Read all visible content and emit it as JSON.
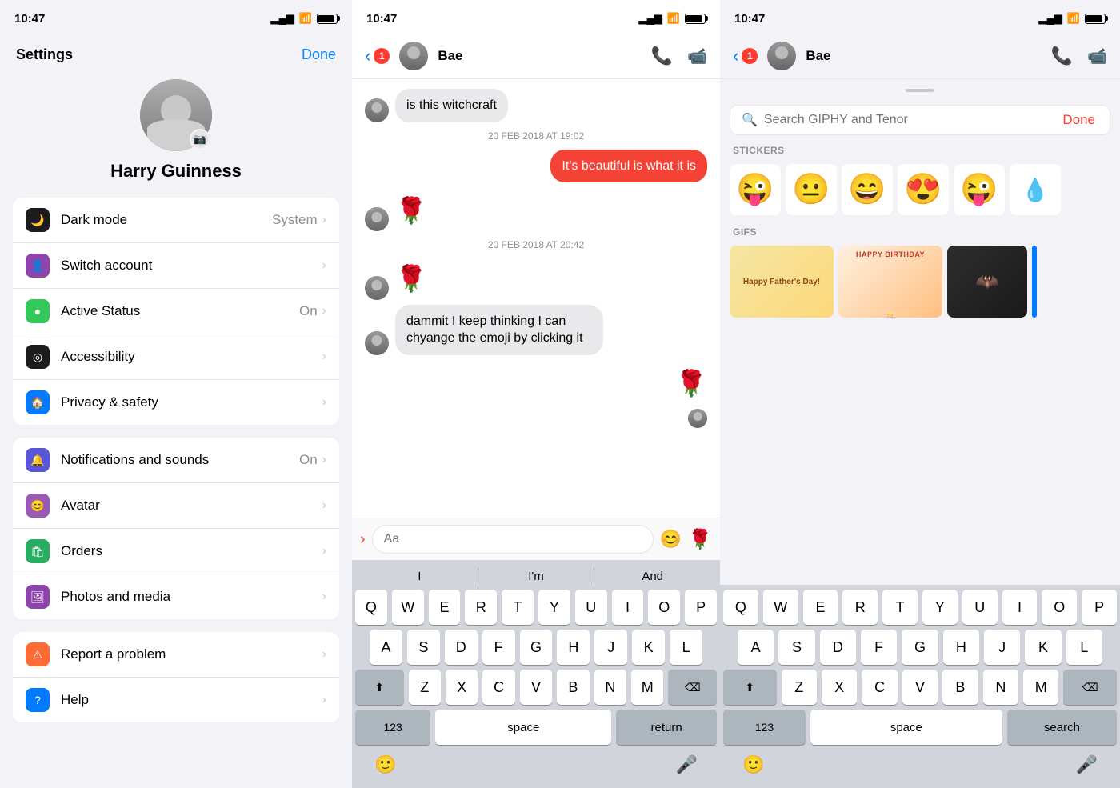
{
  "statusBar": {
    "time": "10:47",
    "signal": "▂▄▆",
    "wifi": "wifi",
    "battery": "battery"
  },
  "settings": {
    "title": "Settings",
    "done": "Done",
    "profileName": "Harry Guinness",
    "items": [
      {
        "id": "dark-mode",
        "label": "Dark mode",
        "value": "System",
        "iconColor": "black",
        "symbol": "🌙"
      },
      {
        "id": "switch-account",
        "label": "Switch account",
        "value": "",
        "iconColor": "purple",
        "symbol": "👤"
      },
      {
        "id": "active-status",
        "label": "Active Status",
        "value": "On",
        "iconColor": "green",
        "symbol": "●"
      },
      {
        "id": "accessibility",
        "label": "Accessibility",
        "value": "",
        "iconColor": "dark",
        "symbol": "◎"
      },
      {
        "id": "privacy-safety",
        "label": "Privacy & safety",
        "value": "",
        "iconColor": "blue",
        "symbol": "🏠"
      }
    ],
    "items2": [
      {
        "id": "notifications",
        "label": "Notifications and sounds",
        "value": "On",
        "iconColor": "purple2",
        "symbol": "🔔"
      },
      {
        "id": "avatar",
        "label": "Avatar",
        "value": "",
        "iconColor": "purple3",
        "symbol": "😊"
      },
      {
        "id": "orders",
        "label": "Orders",
        "value": "",
        "iconColor": "green2",
        "symbol": "🛍"
      },
      {
        "id": "photos-media",
        "label": "Photos and media",
        "value": "",
        "iconColor": "purple4",
        "symbol": "🖼"
      }
    ],
    "items3": [
      {
        "id": "report-problem",
        "label": "Report a problem",
        "value": "",
        "iconColor": "orange",
        "symbol": "⚠"
      },
      {
        "id": "help",
        "label": "Help",
        "value": "",
        "iconColor": "blue2",
        "symbol": "?"
      }
    ]
  },
  "chat": {
    "contactName": "Bae",
    "badge": "1",
    "messages": [
      {
        "type": "received",
        "text": "is this witchcraft",
        "avatar": true
      },
      {
        "type": "timestamp",
        "text": "20 FEB 2018 AT 19:02"
      },
      {
        "type": "sent",
        "text": "It's beautiful is what it is"
      },
      {
        "type": "received-emoji",
        "emoji": "🌹",
        "avatar": true
      },
      {
        "type": "timestamp",
        "text": "20 FEB 2018 AT 20:42"
      },
      {
        "type": "received-emoji",
        "emoji": "🌹",
        "avatar": true
      },
      {
        "type": "received",
        "text": "dammit I keep thinking I can chyange the emoji by clicking it",
        "avatar": true
      },
      {
        "type": "sent-emoji",
        "emoji": "🌹"
      },
      {
        "type": "sent-avatar-small",
        "emoji": "👤"
      }
    ],
    "inputPlaceholder": "Aa",
    "autocomplete": [
      "I",
      "I'm",
      "And"
    ],
    "keyboard": {
      "rows": [
        [
          "Q",
          "W",
          "E",
          "R",
          "T",
          "Y",
          "U",
          "I",
          "O",
          "P"
        ],
        [
          "A",
          "S",
          "D",
          "F",
          "G",
          "H",
          "J",
          "K",
          "L"
        ],
        [
          "Z",
          "X",
          "C",
          "V",
          "B",
          "N",
          "M"
        ]
      ]
    }
  },
  "giphy": {
    "searchPlaceholder": "Search GIPHY and Tenor",
    "done": "Done",
    "stickersLabel": "STICKERS",
    "gifsLabel": "GIFS",
    "stickers": [
      "😜",
      "😐",
      "😄",
      "😍",
      "😜",
      "💧"
    ],
    "contactName": "Bae",
    "badge": "1",
    "keyboard": {
      "rows": [
        [
          "Q",
          "W",
          "E",
          "R",
          "T",
          "Y",
          "U",
          "I",
          "O",
          "P"
        ],
        [
          "A",
          "S",
          "D",
          "F",
          "G",
          "H",
          "J",
          "K",
          "L"
        ],
        [
          "Z",
          "X",
          "C",
          "V",
          "B",
          "N",
          "M"
        ]
      ]
    },
    "searchLabel": "search"
  }
}
